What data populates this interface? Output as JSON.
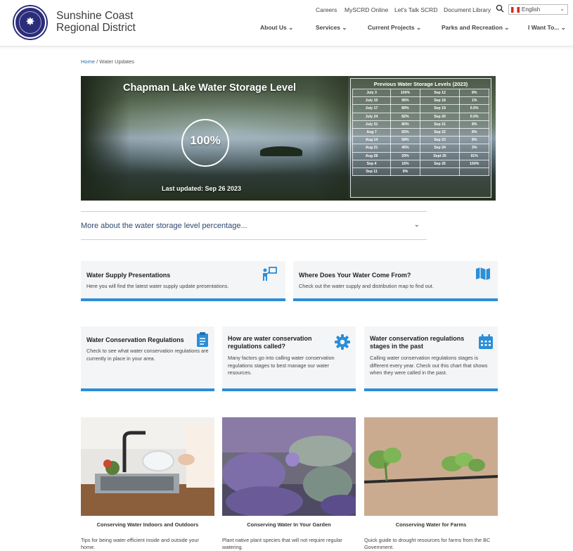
{
  "header": {
    "brand_line1": "Sunshine Coast",
    "brand_line2": "Regional District",
    "logo_text": "SUNSHINE COAST REGIONAL DISTRICT",
    "utility_links": [
      "Careers",
      "MySCRD Online",
      "Let's Talk SCRD",
      "Document Library"
    ],
    "language": "English",
    "nav": [
      "About Us ⌄",
      "Services ⌄",
      "Current Projects ⌄",
      "Parks and Recreation ⌄",
      "I Want To... ⌄"
    ]
  },
  "breadcrumb": {
    "home": "Home",
    "separator": " / ",
    "current": "Water Updates"
  },
  "hero": {
    "title": "Chapman Lake Water Storage Level",
    "percent": "100%",
    "updated": "Last updated: Sep 26 2023",
    "table_title": "Previous Water Storage Levels (2023)",
    "rows": [
      [
        "July 3",
        "100%",
        "Sep 12",
        "8%"
      ],
      [
        "July 10",
        "96%",
        "Sep 18",
        "1%"
      ],
      [
        "July 17",
        "89%",
        "Sep 19",
        "0.5%"
      ],
      [
        "July 24",
        "82%",
        "Sep 20",
        "0.5%"
      ],
      [
        "July 31",
        "80%",
        "Sep 21",
        "8%"
      ],
      [
        "Aug 7",
        "65%",
        "Sep 22",
        "8%"
      ],
      [
        "Aug 14",
        "58%",
        "Sep 23",
        "8%"
      ],
      [
        "Aug 21",
        "45%",
        "Sep 24",
        "3%"
      ],
      [
        "Aug 28",
        "29%",
        "Sept 25",
        "91%"
      ],
      [
        "Sep 4",
        "16%",
        "Sep 26",
        "100%"
      ],
      [
        "Sep 11",
        "9%",
        "",
        ""
      ]
    ]
  },
  "accordion": {
    "label": "More about the water storage level percentage...",
    "chevron": "⌄"
  },
  "cards_row1": [
    {
      "title": "Water Supply Presentations",
      "desc": "Here you will find the latest water supply update presentations.",
      "icon": "presenter-icon"
    },
    {
      "title": "Where Does Your Water Come From?",
      "desc": "Check out the water supply and distribution map to find out.",
      "icon": "map-icon"
    }
  ],
  "cards_row2": [
    {
      "title": "Water Conservation Regulations",
      "desc": "Check to see what water conservation regulations are currently in place in your area.",
      "icon": "clipboard-icon"
    },
    {
      "title": "How are water conservation regulations called?",
      "desc": "Many factors go into calling water conservation regulations stages to best manage our water resources.",
      "icon": "gear-icon"
    },
    {
      "title": "Water conservation regulations stages in the past",
      "desc": "Calling water conservation regulations stages is different every year. Check out this chart that shows when they were called in the past.",
      "icon": "calendar-icon"
    }
  ],
  "tiles": [
    {
      "caption": "Conserving Water Indoors and Outdoors",
      "desc": "Tips for being water efficient inside and outside your home."
    },
    {
      "caption": "Conserving Water In Your Garden",
      "desc": "Plant native plant species that will not require regular watering."
    },
    {
      "caption": "Conserving Water for Farms",
      "desc": "Quick guide to drought resources for farms from the BC Government."
    }
  ],
  "colors": {
    "accent": "#2b8ed8",
    "brand": "#2b2d7a",
    "card_bg": "#f4f5f6"
  }
}
